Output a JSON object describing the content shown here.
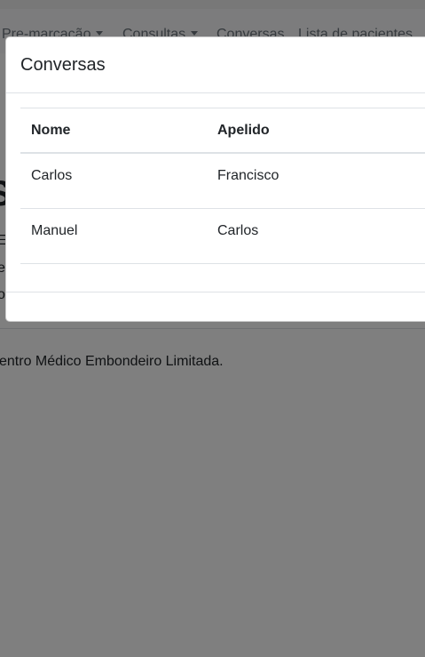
{
  "navbar": {
    "items": [
      {
        "label": "Pre-marcação",
        "dropdown": true
      },
      {
        "label": "Consultas",
        "dropdown": true
      },
      {
        "label": "Conversas",
        "dropdown": false
      },
      {
        "label": "Lista de pacientes",
        "dropdown": false
      }
    ]
  },
  "background": {
    "heading_fragment": "S",
    "line1_fragment": "E",
    "line2_fragment": "e",
    "line3_fragment": "o",
    "footer_text": "entro Médico Embondeiro Limitada."
  },
  "modal": {
    "title": "Conversas",
    "table": {
      "headers": [
        "Nome",
        "Apelido"
      ],
      "rows": [
        {
          "nome": "Carlos",
          "apelido": "Francisco"
        },
        {
          "nome": "Manuel",
          "apelido": "Carlos"
        }
      ]
    }
  },
  "colors": {
    "backdrop": "#000000",
    "border": "#dee2e6",
    "text": "#212529",
    "nav_text": "#6c757d"
  }
}
